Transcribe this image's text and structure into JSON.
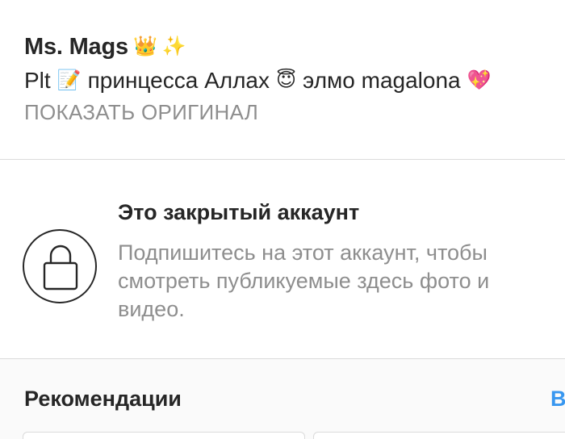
{
  "profile": {
    "name": "Ms. Mags",
    "name_emojis": [
      "👑",
      "✨"
    ],
    "bio_parts": [
      "Plt",
      "📝",
      "принцесса Аллах",
      "😇",
      "элмо magalona",
      "💖"
    ],
    "show_original": "ПОКАЗАТЬ ОРИГИНАЛ"
  },
  "private_account": {
    "icon": "lock-icon",
    "title": "Это закрытый аккаунт",
    "description": "Подпишитесь на этот аккаунт, чтобы смотреть публикуемые здесь фото и видео."
  },
  "recommendations": {
    "title": "Рекомендации",
    "see_all": "В"
  },
  "colors": {
    "text": "#262626",
    "secondary": "#8e8e8e",
    "link": "#3897f0",
    "divider": "#dbdbdb"
  }
}
